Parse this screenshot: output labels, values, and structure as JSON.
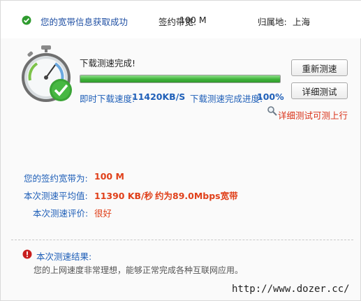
{
  "header": {
    "status_text": "您的宽带信息获取成功",
    "bandwidth_label": "签约带宽:",
    "bandwidth_value": "100 M",
    "location_label": "归属地:",
    "location_value": "上海"
  },
  "download": {
    "title": "下载测速完成!",
    "progress_fraction": 1.0,
    "speed_label": "即时下载速度:",
    "speed_value": "11420KB/S",
    "progress_label": "下载测速完成进度:",
    "progress_value": "100%"
  },
  "buttons": {
    "retest_label": "重新测速",
    "detail_label": "详细测试"
  },
  "detail_link": "详细测试可测上行",
  "results": {
    "contract_label": "您的签约宽带为:",
    "contract_value": "100 M",
    "avg_label": "本次测速平均值:",
    "avg_value": "11390 KB/秒",
    "avg_mbps": "约为89.0Mbps宽带",
    "rating_label": "本次测速评价:",
    "rating_value": "很好"
  },
  "summary": {
    "title": "本次测速结果:",
    "text": "您的上网速度非常理想，能够正常完成各种互联网应用。"
  },
  "watermark": "http://www.dozer.cc/",
  "icons": {
    "status": "check-circle-icon",
    "gauge": "speedometer-icon",
    "detail": "magnifier-tool-icon",
    "alert": "alert-icon"
  },
  "colors": {
    "accent_blue": "#1f5fb8",
    "value_red": "#e0401a",
    "success_green": "#3fb33a"
  }
}
